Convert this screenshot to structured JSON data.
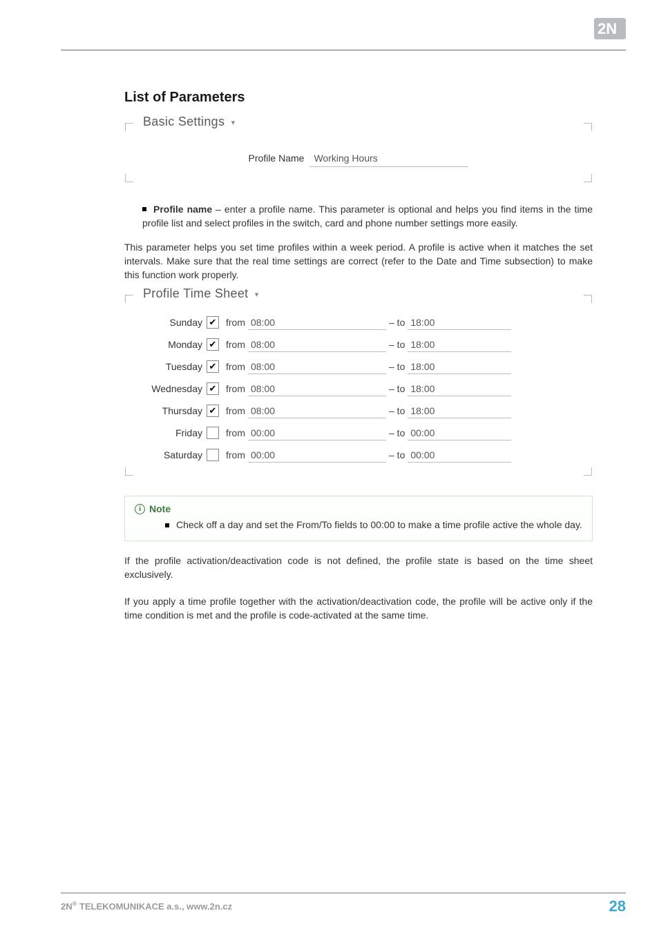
{
  "heading": "List of Parameters",
  "basic_settings": {
    "legend": "Basic Settings",
    "profile_name_label": "Profile Name",
    "profile_name_value": "Working Hours"
  },
  "profile_name_desc": {
    "term": "Profile name",
    "rest": " – enter a profile name. This parameter is optional and helps you find items in the time profile list and select profiles in the switch, card and phone number settings more easily."
  },
  "intro_para": "This parameter helps you set time profiles within a week period. A profile is active when it matches the set intervals. Make sure that the real time settings are correct (refer to the Date and Time subsection) to make this function work properly.",
  "time_sheet": {
    "legend": "Profile Time Sheet",
    "from_label": "from",
    "to_label": "– to",
    "rows": [
      {
        "day": "Sunday",
        "enabled": true,
        "from": "08:00",
        "to": "18:00"
      },
      {
        "day": "Monday",
        "enabled": true,
        "from": "08:00",
        "to": "18:00"
      },
      {
        "day": "Tuesday",
        "enabled": true,
        "from": "08:00",
        "to": "18:00"
      },
      {
        "day": "Wednesday",
        "enabled": true,
        "from": "08:00",
        "to": "18:00"
      },
      {
        "day": "Thursday",
        "enabled": true,
        "from": "08:00",
        "to": "18:00"
      },
      {
        "day": "Friday",
        "enabled": false,
        "from": "00:00",
        "to": "00:00"
      },
      {
        "day": "Saturday",
        "enabled": false,
        "from": "00:00",
        "to": "00:00"
      }
    ]
  },
  "note": {
    "title": "Note",
    "item": "Check off a day and set the From/To fields to 00:00 to make a time profile active the whole day."
  },
  "closing_paras": [
    "If the profile activation/deactivation code is not defined, the profile state is based on the time sheet exclusively.",
    "If you apply a time profile together with the activation/deactivation code, the profile will be active only if the time condition is met and the profile is code-activated at the same time."
  ],
  "footer": {
    "left_prefix": "2N",
    "left_sup": "®",
    "left_rest": " TELEKOMUNIKACE a.s., www.2n.cz",
    "page": "28"
  }
}
